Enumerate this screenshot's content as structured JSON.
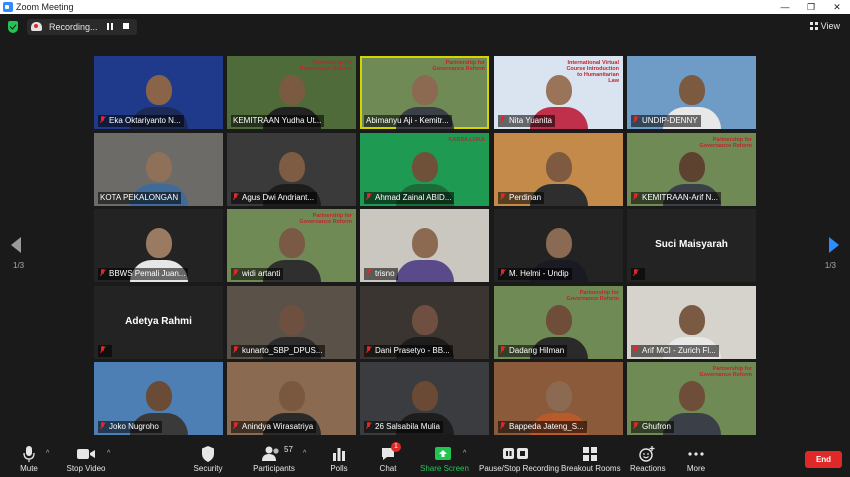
{
  "window": {
    "title": "Zoom Meeting",
    "controls": [
      "—",
      "❐",
      "✕"
    ]
  },
  "topbar": {
    "recording_label": "Recording...",
    "view_label": "View"
  },
  "colors": {
    "accent": "#2d8cff",
    "danger": "#e02828",
    "share_green": "#23c552",
    "active_speaker": "#d4d400"
  },
  "pagination": {
    "left": "1/3",
    "right": "1/3"
  },
  "participants": [
    {
      "name": "Eka Oktariyanto N...",
      "muted": true,
      "bg": "#1f3a8a",
      "skin": "#8a6448",
      "shirt": "#1d2a55"
    },
    {
      "name": "KEMITRAAN Yudha Ut...",
      "muted": false,
      "bg": "#4f6b3a",
      "skin": "#7b5a42",
      "shirt": "#222",
      "banner": "Partnership for Governance Reform"
    },
    {
      "name": "Abimanyu Aji - Kemitr...",
      "muted": false,
      "bg": "#6f8a55",
      "skin": "#8c6a52",
      "shirt": "#3a3f48",
      "banner": "Partnership for Governance Reform",
      "active": true
    },
    {
      "name": "Nita Yuanita",
      "muted": true,
      "bg": "#d9e4f0",
      "skin": "#9a7458",
      "shirt": "#c0304a",
      "banner": "International Virtual Course Introduction to Humanitarian Law"
    },
    {
      "name": "UNDIP-DENNY",
      "muted": true,
      "bg": "#6f9bc7",
      "skin": "#7c5a40",
      "shirt": "#e8e8e8"
    },
    {
      "name": "KOTA PEKALONGAN",
      "muted": false,
      "bg": "#6c6b68",
      "skin": "#8f7058",
      "shirt": "#3f6a9a"
    },
    {
      "name": "Agus Dwi Andriant...",
      "muted": true,
      "bg": "#3a3a3a",
      "skin": "#7e5c44",
      "shirt": "#1d1d1d"
    },
    {
      "name": "Ahmad Zainal ABID...",
      "muted": true,
      "bg": "#1e9a52",
      "skin": "#6f5038",
      "shirt": "#1e6b3a",
      "banner": "KARSA LOKA"
    },
    {
      "name": "Perdinan",
      "muted": true,
      "bg": "#c48a4a",
      "skin": "#7e5a40",
      "shirt": "#2e2e2e"
    },
    {
      "name": "KEMITRAAN-Arif N...",
      "muted": true,
      "bg": "#6f8a55",
      "skin": "#5e4230",
      "shirt": "#3a3f48",
      "banner": "Partnership for Governance Reform"
    },
    {
      "name": "BBWS Pemali Juan...",
      "muted": true,
      "bg": "#232323",
      "skin": "#9a7a60",
      "shirt": "#e6e6e6"
    },
    {
      "name": "widi artanti",
      "muted": true,
      "bg": "#6f8a55",
      "skin": "#7a5a44",
      "shirt": "#2f2f2f",
      "banner": "Partnership for Governance Reform"
    },
    {
      "name": "trisno",
      "muted": true,
      "bg": "#c9c7c0",
      "skin": "#8c6a52",
      "shirt": "#5a4a8a"
    },
    {
      "name": "M. Helmi - Undip",
      "muted": true,
      "bg": "#232323",
      "skin": "#8a6a52",
      "shirt": "#1a1a22"
    },
    {
      "name": "Suci Maisyarah",
      "muted": true,
      "bg": "#232323",
      "nameOnly": true
    },
    {
      "name": "Adetya Rahmi",
      "muted": true,
      "bg": "#232323",
      "nameOnly": true
    },
    {
      "name": "kunarto_SBP_DPUS...",
      "muted": true,
      "bg": "#5a5148",
      "skin": "#6e5040",
      "shirt": "#2c2c2c"
    },
    {
      "name": "Dani Prasetyo - BB...",
      "muted": true,
      "bg": "#3a3530",
      "skin": "#6f5040",
      "shirt": "#1d1d1d"
    },
    {
      "name": "Dadang Hilman",
      "muted": true,
      "bg": "#6f8a55",
      "skin": "#6e4e38",
      "shirt": "#2a2a2a",
      "banner": "Partnership for Governance Reform"
    },
    {
      "name": "Arif MCI - Zurich Fl...",
      "muted": true,
      "bg": "#d6d3cc",
      "skin": "#7a5a42",
      "shirt": "#e8e8e8"
    },
    {
      "name": "Joko Nugroho",
      "muted": true,
      "bg": "#4e7fb4",
      "skin": "#6a4c36",
      "shirt": "#3a3a3a"
    },
    {
      "name": "Anindya Wirasatriya",
      "muted": true,
      "bg": "#8a6a50",
      "skin": "#7a5840",
      "shirt": "#2a2a2a"
    },
    {
      "name": "26 Salsabila Mulia",
      "muted": true,
      "bg": "#3a3c40",
      "skin": "#6a4a34",
      "shirt": "#1d1d1d"
    },
    {
      "name": "Bappeda Jateng_S...",
      "muted": true,
      "bg": "#8a5a3a",
      "skin": "#8c6a52",
      "shirt": "#b85a2a"
    },
    {
      "name": "Ghufron",
      "muted": true,
      "bg": "#6f8a55",
      "skin": "#6e4e38",
      "shirt": "#3a3f48",
      "banner": "Partnership for Governance Reform"
    }
  ],
  "toolbar": {
    "mute": "Mute",
    "stop_video": "Stop Video",
    "security": "Security",
    "participants": "Participants",
    "participants_count": "57",
    "polls": "Polls",
    "chat": "Chat",
    "chat_badge": "1",
    "share_screen": "Share Screen",
    "pause_recording": "Pause/Stop Recording",
    "breakout_rooms": "Breakout Rooms",
    "reactions": "Reactions",
    "more": "More",
    "end": "End"
  }
}
